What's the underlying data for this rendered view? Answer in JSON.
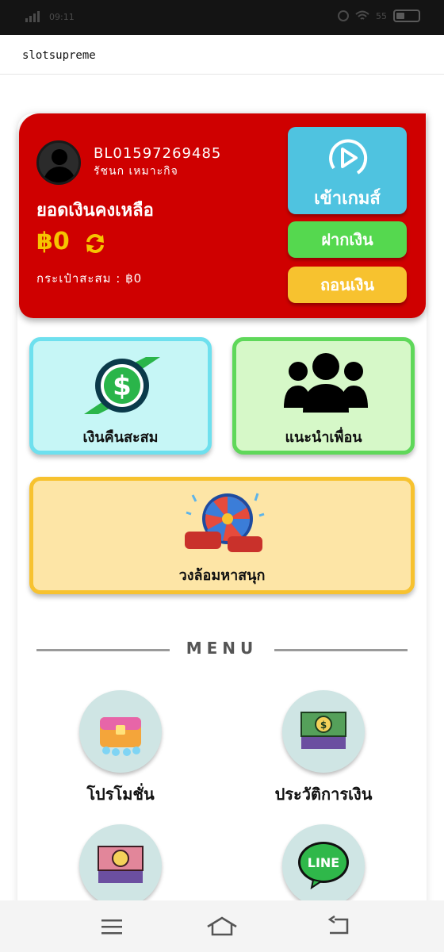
{
  "status_bar": {
    "time": "09:11",
    "battery": "55"
  },
  "browser": {
    "title": "slotsupreme"
  },
  "account": {
    "id": "BL01597269485",
    "name": "รัชนก เหมาะกิจ",
    "balance_label": "ยอดเงินคงเหลือ",
    "balance_value": "฿0",
    "wallet_label": "กระเป๋าสะสม : ฿0"
  },
  "actions": {
    "enter_game": "เข้าเกมส์",
    "deposit": "ฝากเงิน",
    "withdraw": "ถอนเงิน"
  },
  "tiles": {
    "cashback": "เงินคืนสะสม",
    "invite": "แนะนำเพื่อน",
    "wheel": "วงล้อมหาสนุก"
  },
  "menu": {
    "title": "MENU",
    "items": [
      {
        "label": "โปรโมชั่น",
        "icon": "treasure-chest-icon"
      },
      {
        "label": "ประวัติการเงิน",
        "icon": "money-stack-icon"
      },
      {
        "label": "",
        "icon": "money-stack-icon"
      },
      {
        "label": "LINE",
        "icon": "line-icon"
      }
    ]
  },
  "colors": {
    "account_card": "#cf0000",
    "enter": "#4fc3e0",
    "deposit": "#55d84f",
    "withdraw": "#f7c22f",
    "balance": "#f6c400"
  }
}
